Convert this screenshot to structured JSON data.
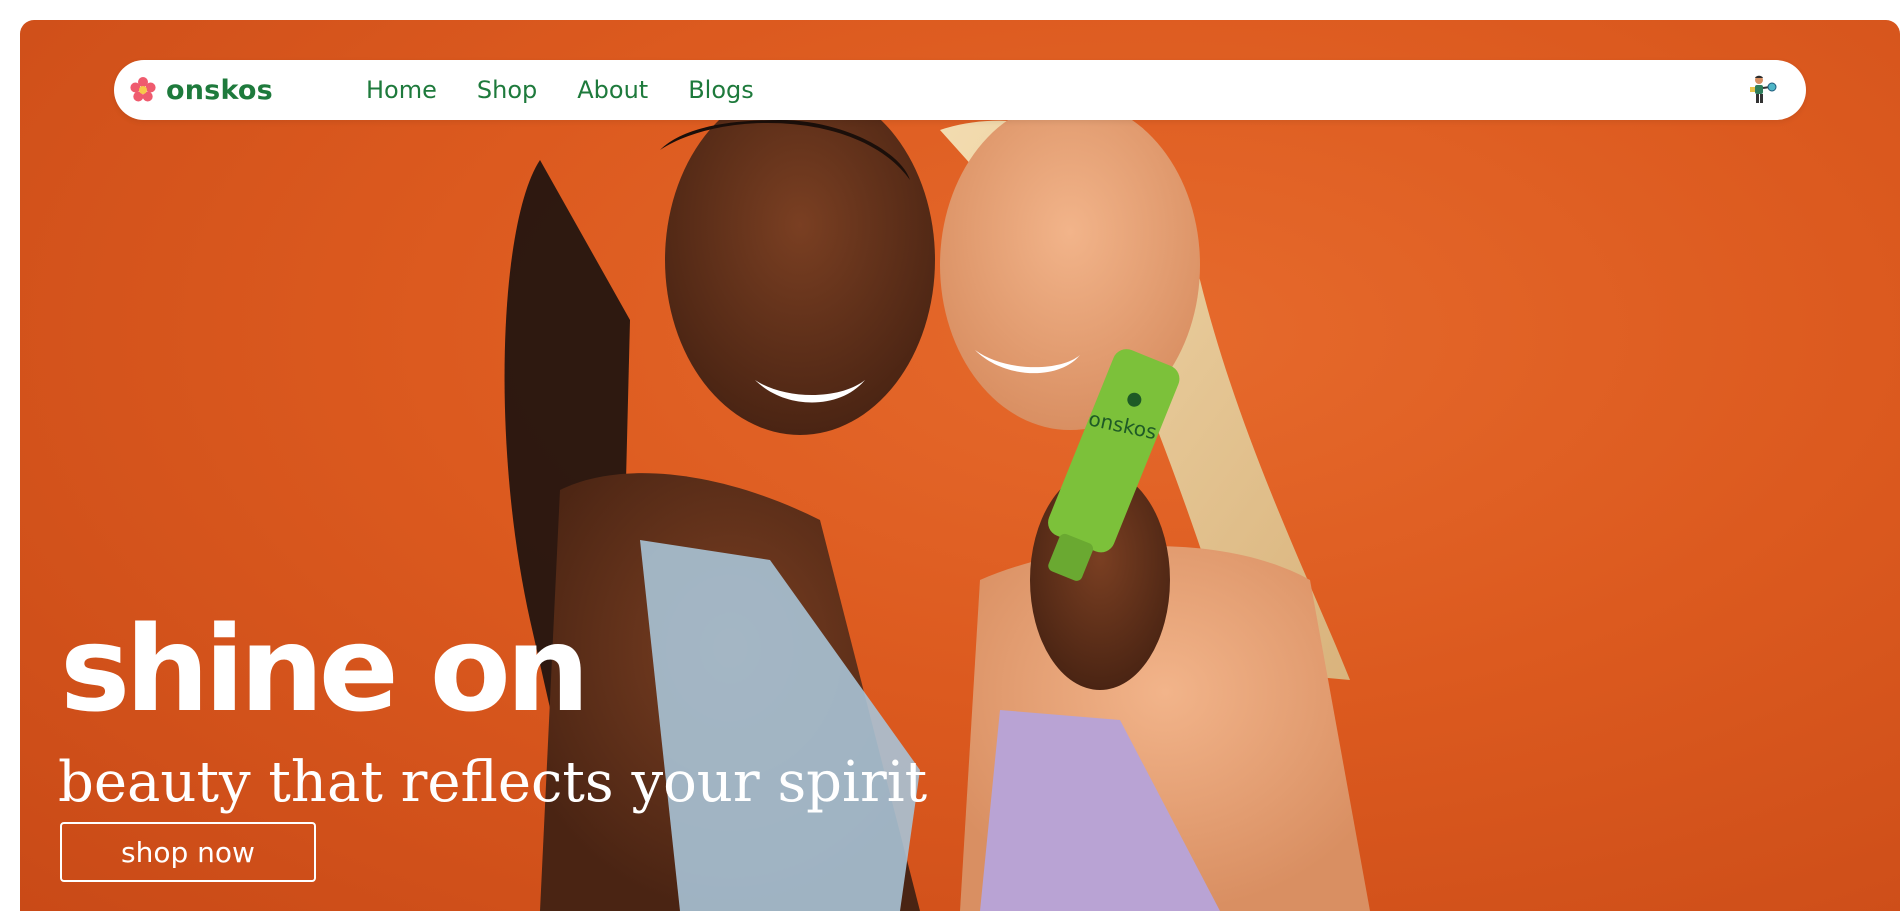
{
  "brand": {
    "name": "onskos",
    "icon": "flower-icon",
    "color": "#1e7a3c"
  },
  "nav": {
    "items": [
      {
        "label": "Home"
      },
      {
        "label": "Shop"
      },
      {
        "label": "About"
      },
      {
        "label": "Blogs"
      }
    ],
    "user_icon": "user-shopping-icon"
  },
  "hero": {
    "headline": "shine on",
    "tagline": "beauty that reflects your spirit",
    "cta_label": "shop now",
    "product_label": "onskos",
    "background_color": "#dc5a1f",
    "product_color": "#7cc13a"
  }
}
